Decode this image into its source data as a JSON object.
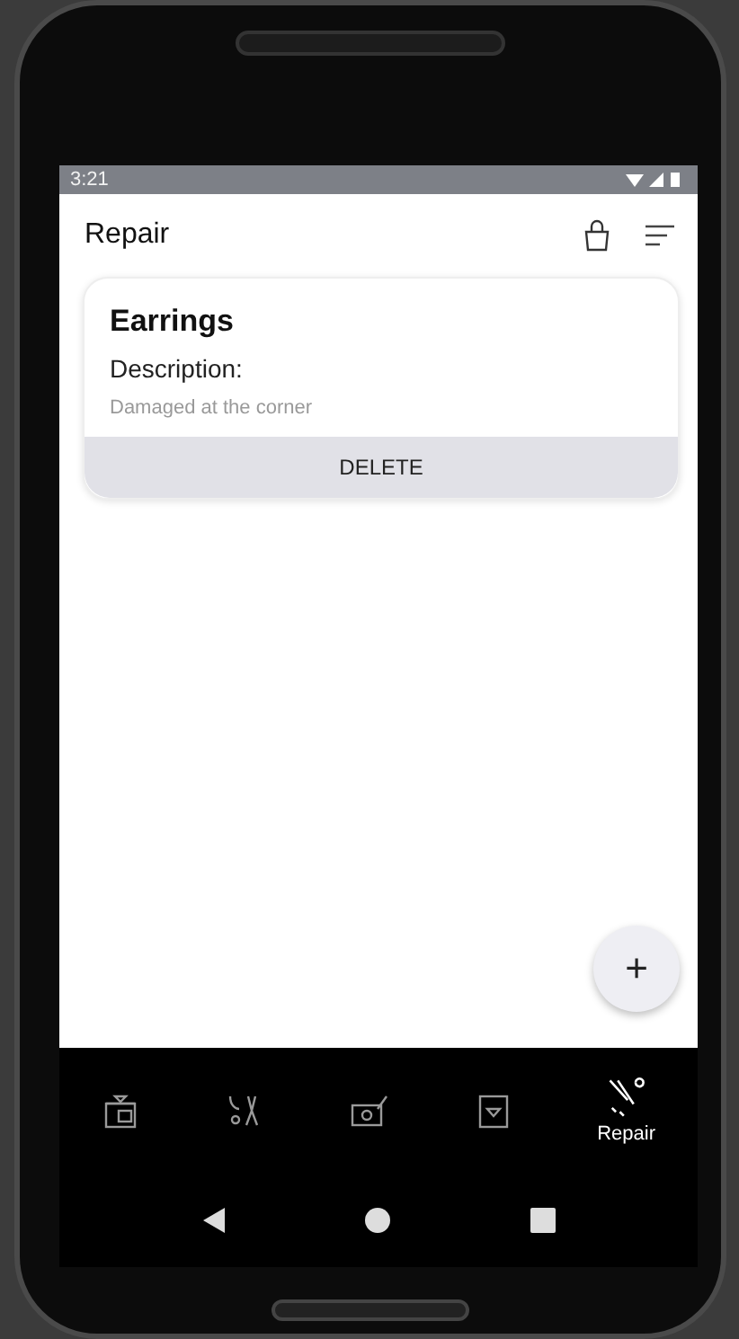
{
  "status_bar": {
    "time": "3:21"
  },
  "app_bar": {
    "title": "Repair"
  },
  "items": [
    {
      "name": "Earrings",
      "description_label": "Description:",
      "description": "Damaged at the corner",
      "action": "DELETE"
    }
  ],
  "fab": {
    "symbol": "+"
  },
  "bottom_nav": [
    {
      "kind": "shop",
      "selected": false
    },
    {
      "kind": "tools",
      "selected": false
    },
    {
      "kind": "craft",
      "selected": false
    },
    {
      "kind": "box",
      "selected": false
    },
    {
      "kind": "repair",
      "label": "Repair",
      "selected": true
    }
  ]
}
